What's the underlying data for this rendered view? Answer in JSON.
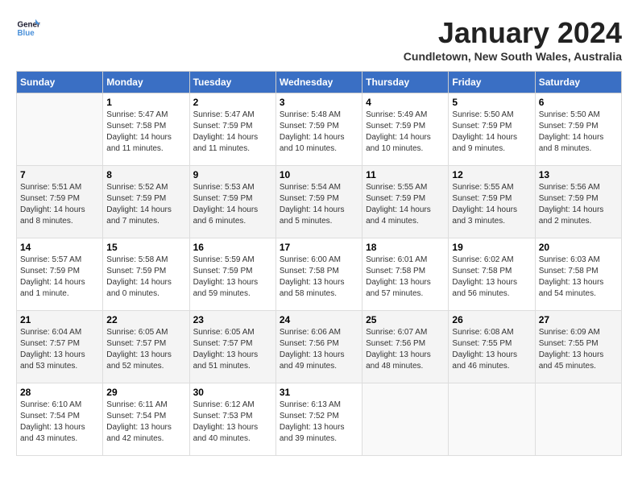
{
  "header": {
    "logo_line1": "General",
    "logo_line2": "Blue",
    "month_title": "January 2024",
    "subtitle": "Cundletown, New South Wales, Australia"
  },
  "weekdays": [
    "Sunday",
    "Monday",
    "Tuesday",
    "Wednesday",
    "Thursday",
    "Friday",
    "Saturday"
  ],
  "weeks": [
    [
      {
        "day": "",
        "sunrise": "",
        "sunset": "",
        "daylight": ""
      },
      {
        "day": "1",
        "sunrise": "5:47 AM",
        "sunset": "7:58 PM",
        "daylight": "14 hours and 11 minutes."
      },
      {
        "day": "2",
        "sunrise": "5:47 AM",
        "sunset": "7:59 PM",
        "daylight": "14 hours and 11 minutes."
      },
      {
        "day": "3",
        "sunrise": "5:48 AM",
        "sunset": "7:59 PM",
        "daylight": "14 hours and 10 minutes."
      },
      {
        "day": "4",
        "sunrise": "5:49 AM",
        "sunset": "7:59 PM",
        "daylight": "14 hours and 10 minutes."
      },
      {
        "day": "5",
        "sunrise": "5:50 AM",
        "sunset": "7:59 PM",
        "daylight": "14 hours and 9 minutes."
      },
      {
        "day": "6",
        "sunrise": "5:50 AM",
        "sunset": "7:59 PM",
        "daylight": "14 hours and 8 minutes."
      }
    ],
    [
      {
        "day": "7",
        "sunrise": "5:51 AM",
        "sunset": "7:59 PM",
        "daylight": "14 hours and 8 minutes."
      },
      {
        "day": "8",
        "sunrise": "5:52 AM",
        "sunset": "7:59 PM",
        "daylight": "14 hours and 7 minutes."
      },
      {
        "day": "9",
        "sunrise": "5:53 AM",
        "sunset": "7:59 PM",
        "daylight": "14 hours and 6 minutes."
      },
      {
        "day": "10",
        "sunrise": "5:54 AM",
        "sunset": "7:59 PM",
        "daylight": "14 hours and 5 minutes."
      },
      {
        "day": "11",
        "sunrise": "5:55 AM",
        "sunset": "7:59 PM",
        "daylight": "14 hours and 4 minutes."
      },
      {
        "day": "12",
        "sunrise": "5:55 AM",
        "sunset": "7:59 PM",
        "daylight": "14 hours and 3 minutes."
      },
      {
        "day": "13",
        "sunrise": "5:56 AM",
        "sunset": "7:59 PM",
        "daylight": "14 hours and 2 minutes."
      }
    ],
    [
      {
        "day": "14",
        "sunrise": "5:57 AM",
        "sunset": "7:59 PM",
        "daylight": "14 hours and 1 minute."
      },
      {
        "day": "15",
        "sunrise": "5:58 AM",
        "sunset": "7:59 PM",
        "daylight": "14 hours and 0 minutes."
      },
      {
        "day": "16",
        "sunrise": "5:59 AM",
        "sunset": "7:59 PM",
        "daylight": "13 hours and 59 minutes."
      },
      {
        "day": "17",
        "sunrise": "6:00 AM",
        "sunset": "7:58 PM",
        "daylight": "13 hours and 58 minutes."
      },
      {
        "day": "18",
        "sunrise": "6:01 AM",
        "sunset": "7:58 PM",
        "daylight": "13 hours and 57 minutes."
      },
      {
        "day": "19",
        "sunrise": "6:02 AM",
        "sunset": "7:58 PM",
        "daylight": "13 hours and 56 minutes."
      },
      {
        "day": "20",
        "sunrise": "6:03 AM",
        "sunset": "7:58 PM",
        "daylight": "13 hours and 54 minutes."
      }
    ],
    [
      {
        "day": "21",
        "sunrise": "6:04 AM",
        "sunset": "7:57 PM",
        "daylight": "13 hours and 53 minutes."
      },
      {
        "day": "22",
        "sunrise": "6:05 AM",
        "sunset": "7:57 PM",
        "daylight": "13 hours and 52 minutes."
      },
      {
        "day": "23",
        "sunrise": "6:05 AM",
        "sunset": "7:57 PM",
        "daylight": "13 hours and 51 minutes."
      },
      {
        "day": "24",
        "sunrise": "6:06 AM",
        "sunset": "7:56 PM",
        "daylight": "13 hours and 49 minutes."
      },
      {
        "day": "25",
        "sunrise": "6:07 AM",
        "sunset": "7:56 PM",
        "daylight": "13 hours and 48 minutes."
      },
      {
        "day": "26",
        "sunrise": "6:08 AM",
        "sunset": "7:55 PM",
        "daylight": "13 hours and 46 minutes."
      },
      {
        "day": "27",
        "sunrise": "6:09 AM",
        "sunset": "7:55 PM",
        "daylight": "13 hours and 45 minutes."
      }
    ],
    [
      {
        "day": "28",
        "sunrise": "6:10 AM",
        "sunset": "7:54 PM",
        "daylight": "13 hours and 43 minutes."
      },
      {
        "day": "29",
        "sunrise": "6:11 AM",
        "sunset": "7:54 PM",
        "daylight": "13 hours and 42 minutes."
      },
      {
        "day": "30",
        "sunrise": "6:12 AM",
        "sunset": "7:53 PM",
        "daylight": "13 hours and 40 minutes."
      },
      {
        "day": "31",
        "sunrise": "6:13 AM",
        "sunset": "7:52 PM",
        "daylight": "13 hours and 39 minutes."
      },
      {
        "day": "",
        "sunrise": "",
        "sunset": "",
        "daylight": ""
      },
      {
        "day": "",
        "sunrise": "",
        "sunset": "",
        "daylight": ""
      },
      {
        "day": "",
        "sunrise": "",
        "sunset": "",
        "daylight": ""
      }
    ]
  ],
  "labels": {
    "sunrise_prefix": "Sunrise: ",
    "sunset_prefix": "Sunset: ",
    "daylight_prefix": "Daylight: "
  }
}
